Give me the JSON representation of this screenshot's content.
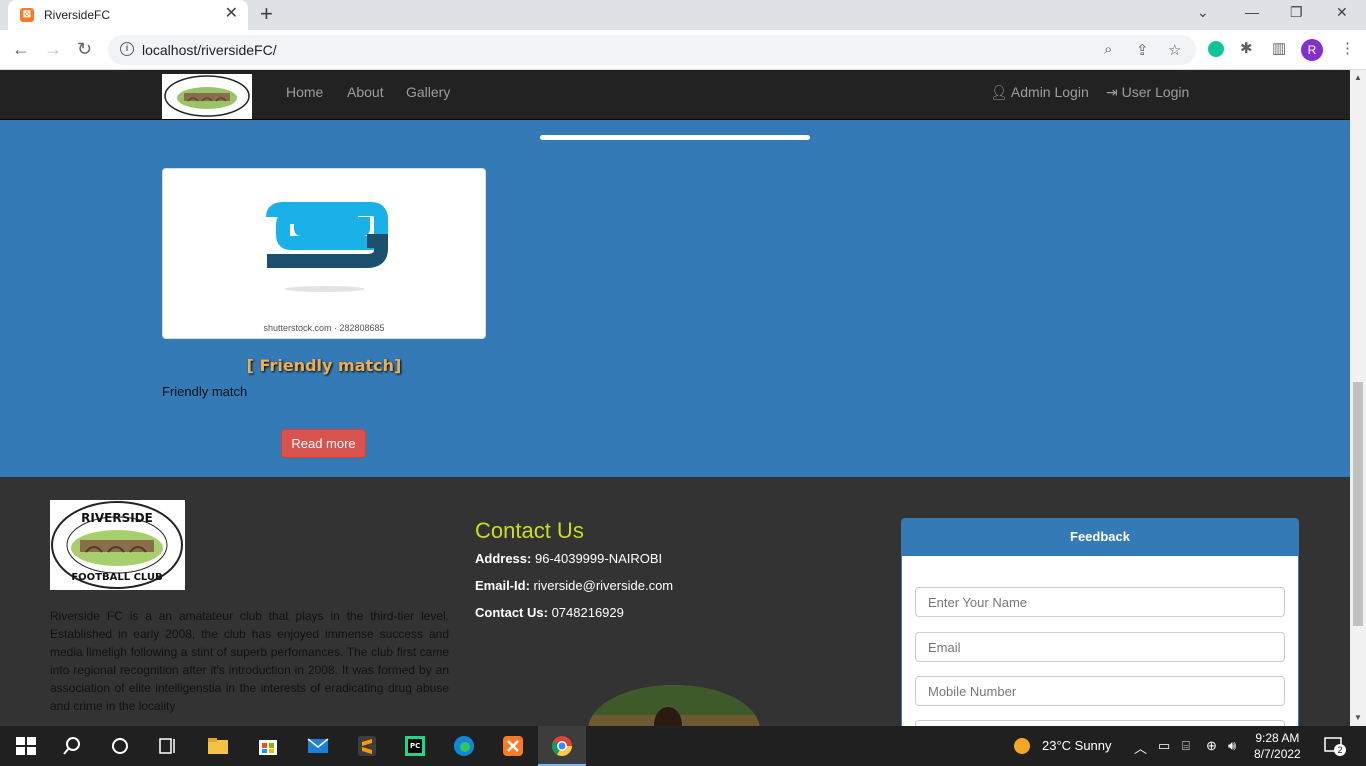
{
  "browser": {
    "tab_title": "RiversideFC",
    "tab_favicon": "xampp-icon",
    "url": "localhost/riversideFC/",
    "profile_initial": "R"
  },
  "site_nav": {
    "links": [
      "Home",
      "About",
      "Gallery"
    ],
    "admin_login": "Admin Login",
    "user_login": "User Login"
  },
  "event": {
    "watermark": "shutterstock.com · 282808685",
    "title": "[ Friendly match]",
    "description": "Friendly match",
    "read_more": "Read more"
  },
  "footer": {
    "logo_top_text": "RIVERSIDE",
    "logo_bottom_text": "FOOTBALL CLUB",
    "about": "Riverside FC is a an amatateur club that plays in the third-tier level. Established in early 2008, the club has enjoyed immense success and media limeligh following a stint of superb perfomances. The club first came into regional recognition after it's introduction in 2008. It was formed by an association of elite intelligenstia in the interests of eradicating drug abuse and crime in the locality",
    "contact": {
      "heading": "Contact Us",
      "address_label": "Address:",
      "address_value": " 96-4039999-NAIROBI",
      "email_label": "Email-Id:",
      "email_value": " riverside@riverside.com",
      "phone_label": "Contact Us:",
      "phone_value": " 0748216929"
    },
    "feedback": {
      "heading": "Feedback",
      "name_placeholder": "Enter Your Name",
      "email_placeholder": "Email",
      "mobile_placeholder": "Mobile Number"
    }
  },
  "taskbar": {
    "weather": "23°C  Sunny",
    "time": "9:28 AM",
    "date": "8/7/2022",
    "notifications": "2"
  },
  "colors": {
    "accent_blue": "#337ab7",
    "nav_dark": "#222222",
    "footer_dark": "#333333",
    "danger_red": "#d9534f",
    "contact_yellow": "#c9de1f",
    "event_title": "#f0ad4e"
  }
}
